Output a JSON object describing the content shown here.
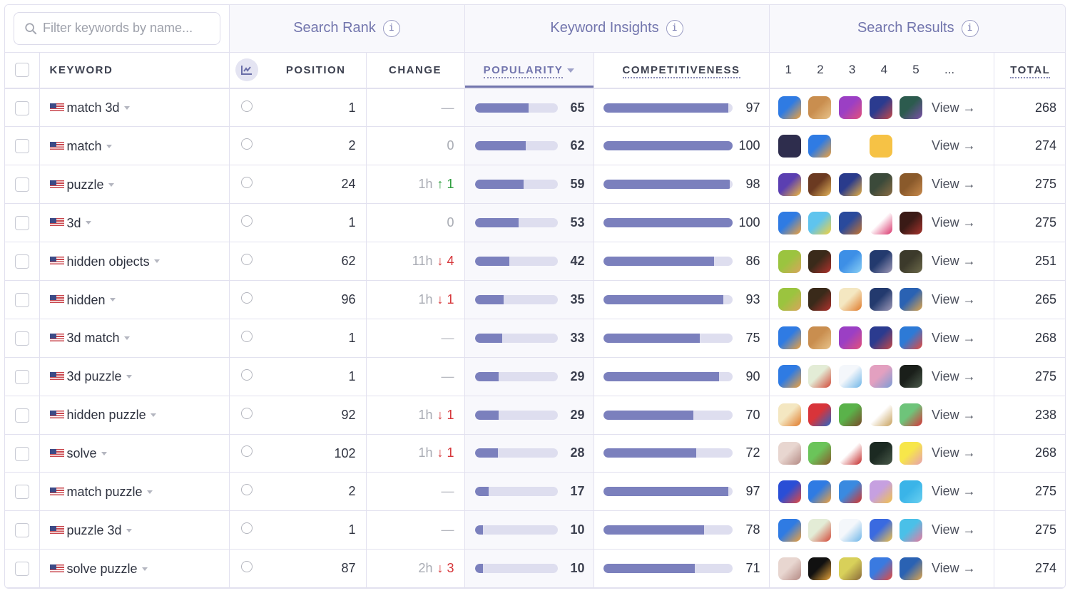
{
  "search": {
    "placeholder": "Filter keywords by name..."
  },
  "groups": {
    "search_rank": "Search Rank",
    "keyword_insights": "Keyword Insights",
    "search_results": "Search Results",
    "info_glyph": "i"
  },
  "columns": {
    "keyword": "KEYWORD",
    "position": "POSITION",
    "change": "CHANGE",
    "popularity": "POPULARITY",
    "competitiveness": "COMPETITIVENESS",
    "result_ranks": [
      "1",
      "2",
      "3",
      "4",
      "5",
      "..."
    ],
    "total": "TOTAL"
  },
  "sort": {
    "column": "popularity",
    "direction": "desc"
  },
  "colors": {
    "accent": "#7275ad",
    "bar_fill": "#7b80bd",
    "bar_track": "#dedeef",
    "up": "#2e9e3e",
    "down": "#d6363a"
  },
  "view_label": "View →",
  "rows": [
    {
      "keyword": "match 3d",
      "country": "US",
      "position": "1",
      "change_time": "",
      "change_dir": "none",
      "change_val": "—",
      "popularity": 65,
      "competitiveness": 97,
      "total": "268",
      "apps": [
        [
          "#2f7be3",
          "#f2a23a"
        ],
        [
          "#c98e4f",
          "#e8c38a"
        ],
        [
          "#9b3fc4",
          "#e4507a"
        ],
        [
          "#2b3b8f",
          "#c74848"
        ],
        [
          "#2c5b4e",
          "#7b4fa8"
        ]
      ]
    },
    {
      "keyword": "match",
      "country": "US",
      "position": "2",
      "change_time": "",
      "change_dir": "zero",
      "change_val": "0",
      "popularity": 62,
      "competitiveness": 100,
      "total": "274",
      "apps": [
        [
          "#2e2d4d",
          "#2e2d4d"
        ],
        [
          "#2f7be3",
          "#f2a23a"
        ],
        [
          "#ffffff",
          "#ffffff"
        ],
        [
          "#f6c245",
          "#f6c245"
        ],
        [
          "#ffffff",
          "#ffffff"
        ]
      ]
    },
    {
      "keyword": "puzzle",
      "country": "US",
      "position": "24",
      "change_time": "1h",
      "change_dir": "up",
      "change_val": "1",
      "popularity": 59,
      "competitiveness": 98,
      "total": "275",
      "apps": [
        [
          "#5b3fb1",
          "#f1b93c"
        ],
        [
          "#6b3a21",
          "#e4b45b"
        ],
        [
          "#2a3b8c",
          "#e9b041"
        ],
        [
          "#3b4a3a",
          "#8a6d44"
        ],
        [
          "#8a5a2b",
          "#c88a4c"
        ]
      ]
    },
    {
      "keyword": "3d",
      "country": "US",
      "position": "1",
      "change_time": "",
      "change_dir": "zero",
      "change_val": "0",
      "popularity": 53,
      "competitiveness": 100,
      "total": "275",
      "apps": [
        [
          "#2f7be3",
          "#f2a23a"
        ],
        [
          "#5fc4ee",
          "#f4d23c"
        ],
        [
          "#2a4a9c",
          "#c8752e"
        ],
        [
          "#ffffff",
          "#d9336b"
        ],
        [
          "#3a1a16",
          "#a8342d"
        ]
      ]
    },
    {
      "keyword": "hidden objects",
      "country": "US",
      "position": "62",
      "change_time": "11h",
      "change_dir": "down",
      "change_val": "4",
      "popularity": 42,
      "competitiveness": 86,
      "total": "251",
      "apps": [
        [
          "#9bc43f",
          "#d9a55b"
        ],
        [
          "#3a2a1a",
          "#b0322d"
        ],
        [
          "#3d8fe6",
          "#8ad0f5"
        ],
        [
          "#233a6e",
          "#a09ab8"
        ],
        [
          "#3c3a2b",
          "#6d6a4a"
        ]
      ]
    },
    {
      "keyword": "hidden",
      "country": "US",
      "position": "96",
      "change_time": "1h",
      "change_dir": "down",
      "change_val": "1",
      "popularity": 35,
      "competitiveness": 93,
      "total": "265",
      "apps": [
        [
          "#9bc43f",
          "#d9a55b"
        ],
        [
          "#3a2a1a",
          "#b0322d"
        ],
        [
          "#f4e7c1",
          "#e07a2a"
        ],
        [
          "#233a6e",
          "#a09ab8"
        ],
        [
          "#2a62b3",
          "#e0a64a"
        ]
      ]
    },
    {
      "keyword": "3d match",
      "country": "US",
      "position": "1",
      "change_time": "",
      "change_dir": "none",
      "change_val": "—",
      "popularity": 33,
      "competitiveness": 75,
      "total": "268",
      "apps": [
        [
          "#2f7be3",
          "#f2a23a"
        ],
        [
          "#c98e4f",
          "#e8c38a"
        ],
        [
          "#9b3fc4",
          "#e4507a"
        ],
        [
          "#2b3b8f",
          "#c74848"
        ],
        [
          "#2d7ad6",
          "#e8483c"
        ]
      ]
    },
    {
      "keyword": "3d puzzle",
      "country": "US",
      "position": "1",
      "change_time": "",
      "change_dir": "none",
      "change_val": "—",
      "popularity": 29,
      "competitiveness": 90,
      "total": "275",
      "apps": [
        [
          "#2f7be3",
          "#f2a23a"
        ],
        [
          "#e3ecd6",
          "#d34a3a"
        ],
        [
          "#f4f7fb",
          "#6fb6e8"
        ],
        [
          "#e3a0c0",
          "#7c9dd6"
        ],
        [
          "#1a1f1a",
          "#4b5a4b"
        ]
      ]
    },
    {
      "keyword": "hidden puzzle",
      "country": "US",
      "position": "92",
      "change_time": "1h",
      "change_dir": "down",
      "change_val": "1",
      "popularity": 29,
      "competitiveness": 70,
      "total": "238",
      "apps": [
        [
          "#f4e7c1",
          "#e07a2a"
        ],
        [
          "#d8343a",
          "#2a66c4"
        ],
        [
          "#5ab24a",
          "#7a4a2a"
        ],
        [
          "#ffffff",
          "#c7a05a"
        ],
        [
          "#6ec47a",
          "#d8343a"
        ]
      ]
    },
    {
      "keyword": "solve",
      "country": "US",
      "position": "102",
      "change_time": "1h",
      "change_dir": "down",
      "change_val": "1",
      "popularity": 28,
      "competitiveness": 72,
      "total": "268",
      "apps": [
        [
          "#e8d6d0",
          "#b48a84"
        ],
        [
          "#6bc45a",
          "#8a5a2b"
        ],
        [
          "#ffffff",
          "#c42a2a"
        ],
        [
          "#1c2a22",
          "#4a5a4a"
        ],
        [
          "#f7e64a",
          "#e8a0b0"
        ]
      ]
    },
    {
      "keyword": "match puzzle",
      "country": "US",
      "position": "2",
      "change_time": "",
      "change_dir": "none",
      "change_val": "—",
      "popularity": 17,
      "competitiveness": 97,
      "total": "275",
      "apps": [
        [
          "#2a4ed6",
          "#e8483c"
        ],
        [
          "#2f7be3",
          "#f2a23a"
        ],
        [
          "#3a8ae0",
          "#d8342a"
        ],
        [
          "#c6a0e0",
          "#f2c24a"
        ],
        [
          "#3ab4e8",
          "#6ad0f0"
        ]
      ]
    },
    {
      "keyword": "puzzle 3d",
      "country": "US",
      "position": "1",
      "change_time": "",
      "change_dir": "none",
      "change_val": "—",
      "popularity": 10,
      "competitiveness": 78,
      "total": "275",
      "apps": [
        [
          "#2f7be3",
          "#f2a23a"
        ],
        [
          "#e3ecd6",
          "#d34a3a"
        ],
        [
          "#f4f7fb",
          "#6fb6e8"
        ],
        [
          "#3a6ae0",
          "#f2c24a"
        ],
        [
          "#4ac0e8",
          "#e87aa0"
        ]
      ]
    },
    {
      "keyword": "solve puzzle",
      "country": "US",
      "position": "87",
      "change_time": "2h",
      "change_dir": "down",
      "change_val": "3",
      "popularity": 10,
      "competitiveness": 71,
      "total": "274",
      "apps": [
        [
          "#e8d6d0",
          "#b48a84"
        ],
        [
          "#111111",
          "#e8a43a"
        ],
        [
          "#d8d05a",
          "#8a6a3a"
        ],
        [
          "#3a7ae0",
          "#e8483c"
        ],
        [
          "#2a62b3",
          "#e0a64a"
        ]
      ]
    }
  ]
}
